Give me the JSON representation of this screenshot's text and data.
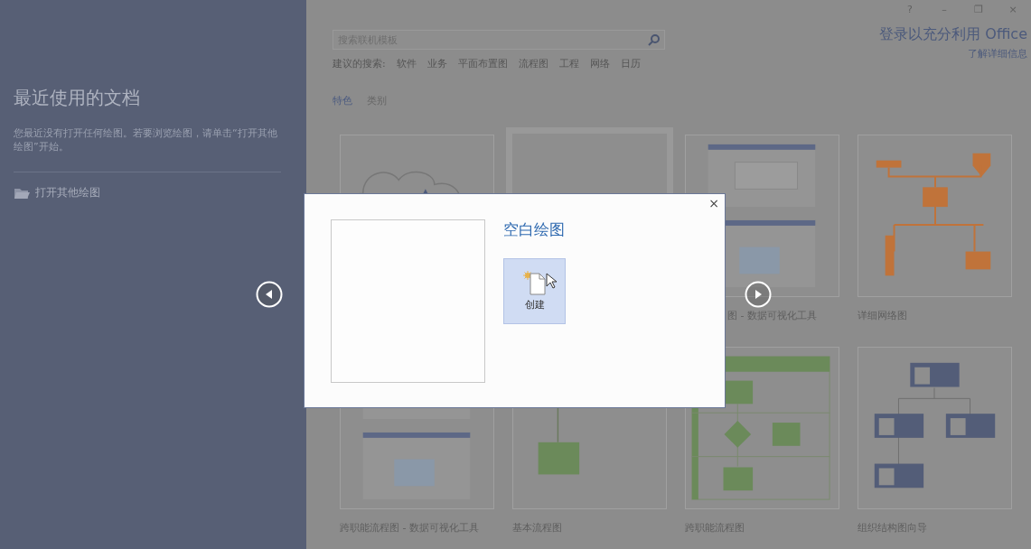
{
  "window_controls": [
    "?",
    "–",
    "❐",
    "×"
  ],
  "sidebar": {
    "title": "最近使用的文档",
    "message": "您最近没有打开任何绘图。若要浏览绘图，请单击“打开其他绘图”开始。",
    "open_other": "打开其他绘图"
  },
  "search": {
    "placeholder": "搜索联机模板"
  },
  "suggested": {
    "label": "建议的搜索:",
    "items": [
      "软件",
      "业务",
      "平面布置图",
      "流程图",
      "工程",
      "网络",
      "日历"
    ]
  },
  "account": {
    "sign_in": "登录以充分利用 Office",
    "learn_more": "了解详细信息"
  },
  "tabs": [
    {
      "label": "特色",
      "selected": true
    },
    {
      "label": "类别",
      "selected": false
    }
  ],
  "templates": [
    {
      "kind": "cloud",
      "selected": false
    },
    {
      "kind": "blank",
      "selected": true
    },
    {
      "kind": "screens",
      "selected": false,
      "label": "图 - 数据可视化工具"
    },
    {
      "kind": "network",
      "selected": false,
      "label": "详细网络图"
    },
    {
      "kind": "screens",
      "selected": false,
      "label": "跨职能流程图 - 数据可视化工具"
    },
    {
      "kind": "flowchart",
      "selected": false,
      "label": "基本流程图"
    },
    {
      "kind": "crossflow",
      "selected": false,
      "label": "跨职能流程图"
    },
    {
      "kind": "org",
      "selected": false,
      "label": "组织结构图向导"
    }
  ],
  "dialog": {
    "title": "空白绘图",
    "create": "创建",
    "close": "×"
  }
}
